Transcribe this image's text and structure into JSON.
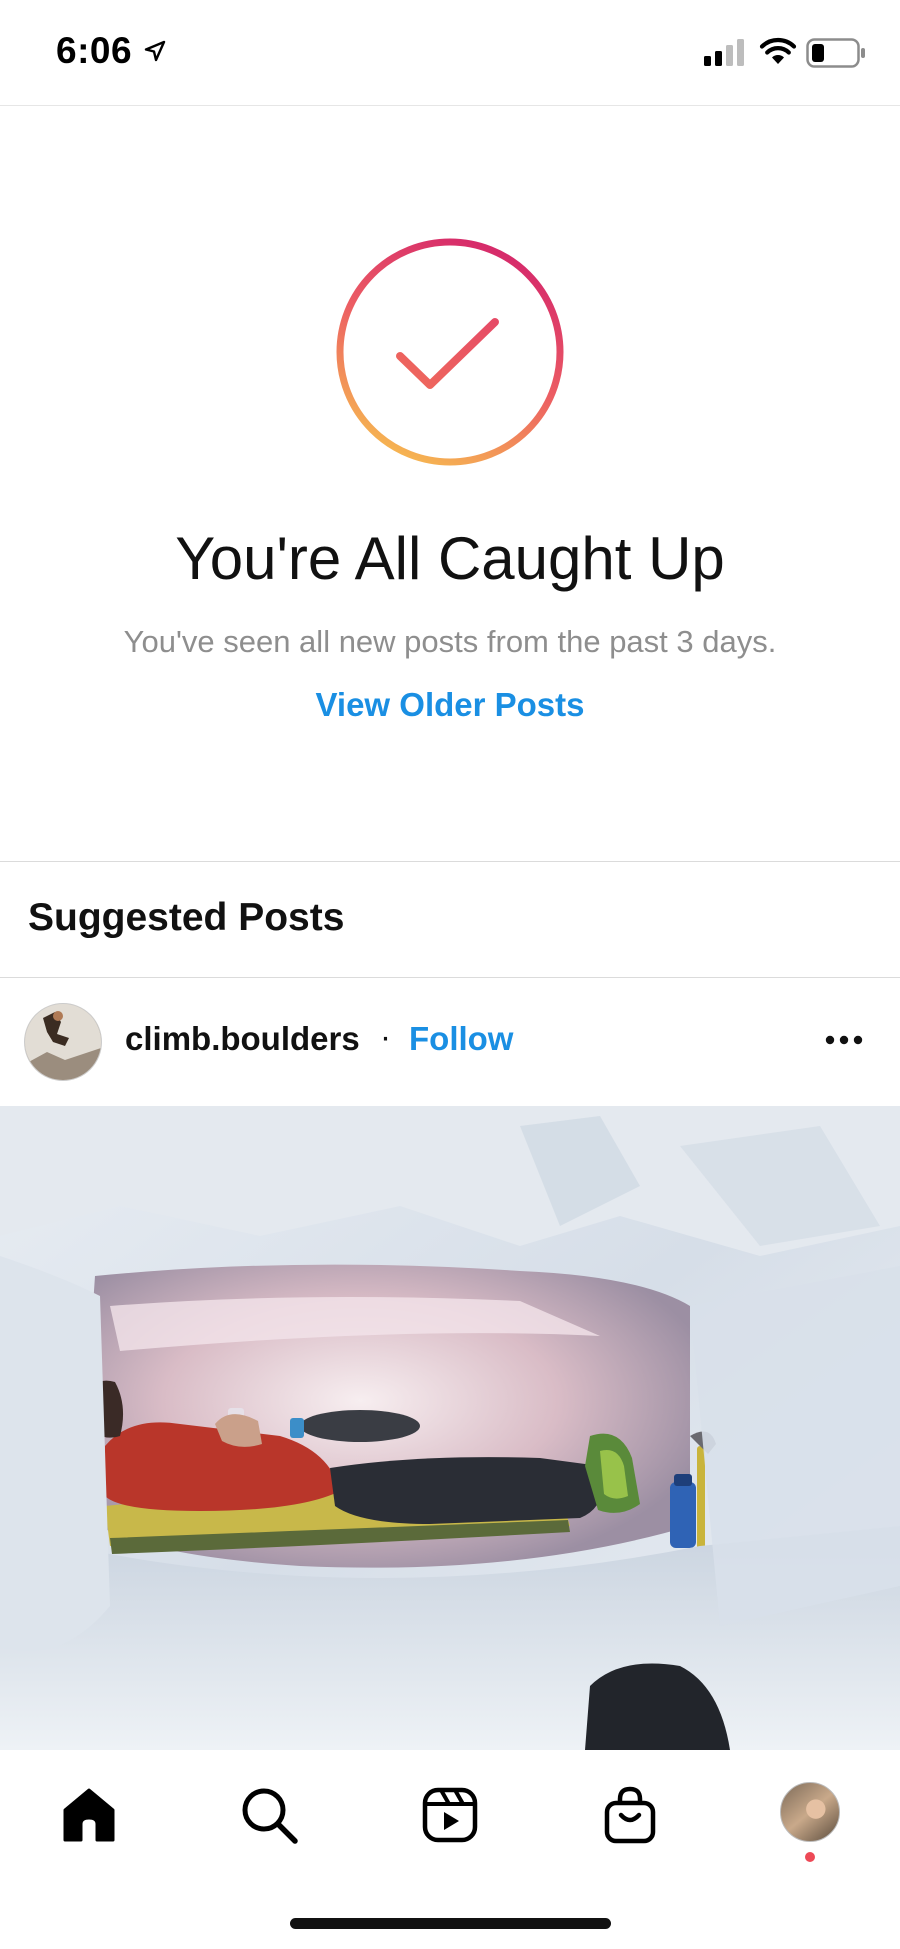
{
  "status_bar": {
    "time": "6:06",
    "icons": [
      "location-arrow-icon",
      "cellular-signal-icon",
      "wifi-icon",
      "battery-icon"
    ]
  },
  "caught_up": {
    "icon": "checkmark-circle-icon",
    "title": "You're All Caught Up",
    "subtitle": "You've seen all new posts from the past 3 days.",
    "older_link": "View Older Posts"
  },
  "suggested": {
    "header": "Suggested Posts"
  },
  "post": {
    "username": "climb.boulders",
    "separator": "·",
    "follow_label": "Follow",
    "more_icon": "more-horizontal-icon"
  },
  "tab_bar": {
    "tabs": [
      "home-icon",
      "search-icon",
      "reels-icon",
      "shop-icon",
      "profile-avatar"
    ],
    "active": "home-icon"
  },
  "colors": {
    "link_blue": "#1a8fe3",
    "gradient_start": "#d4266b",
    "gradient_end": "#f6b751",
    "secondary_text": "#8e8e8e",
    "notification_dot": "#ed4956"
  }
}
